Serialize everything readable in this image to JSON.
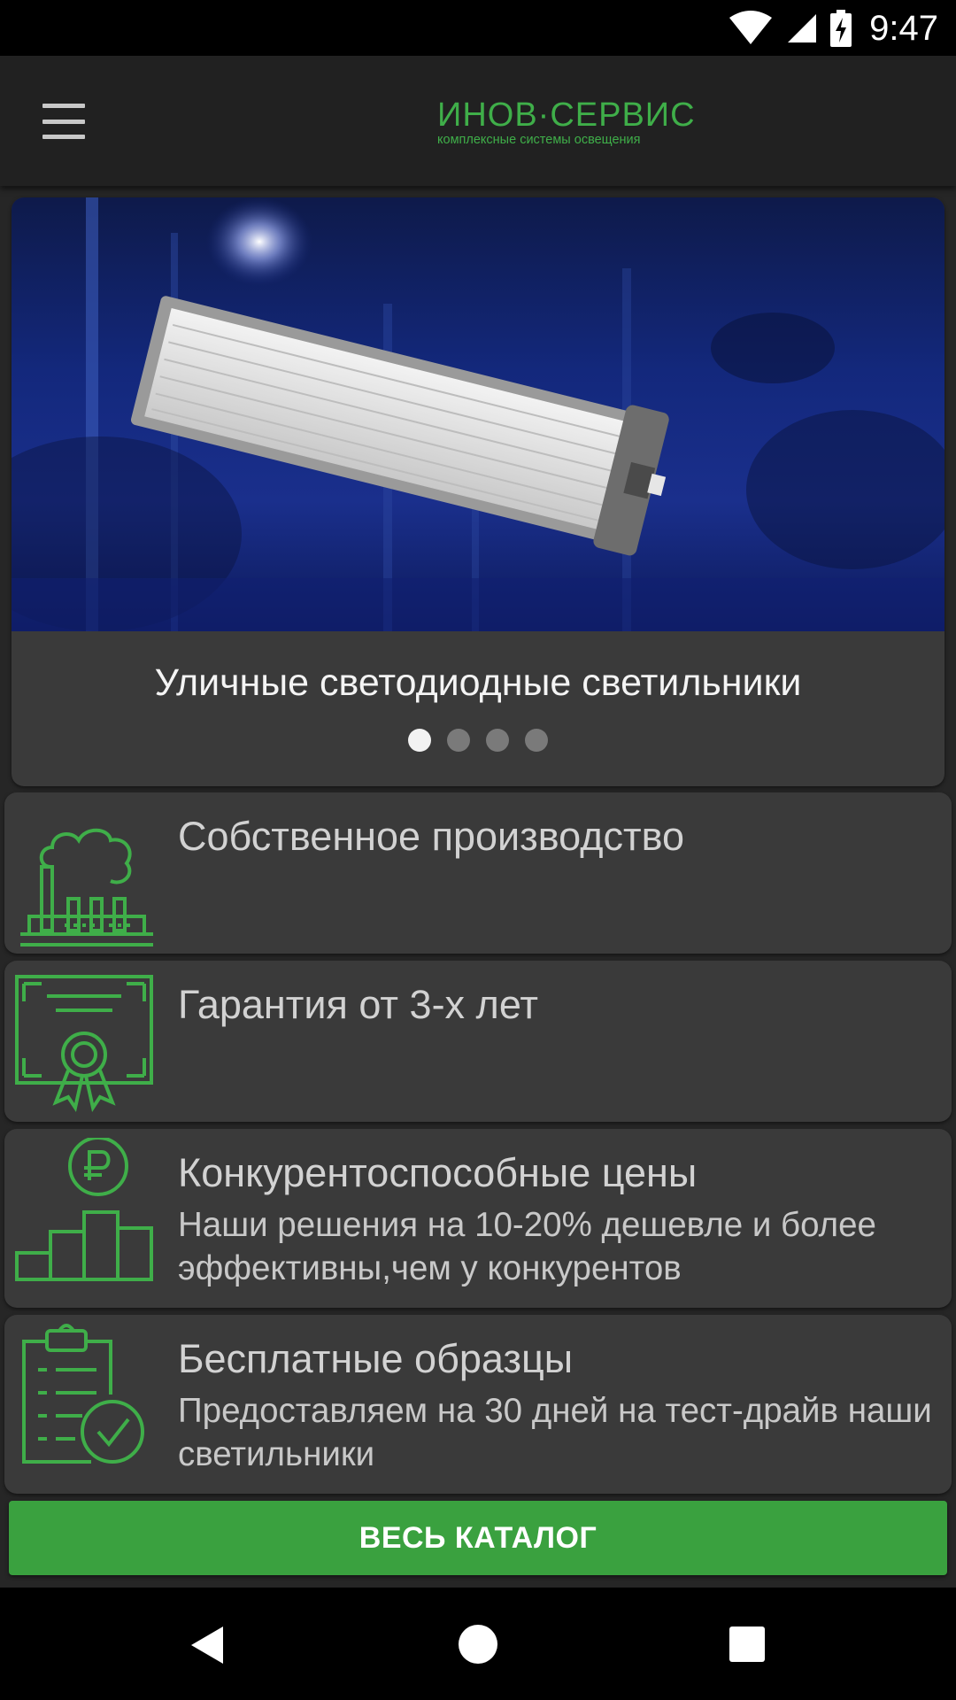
{
  "status_bar": {
    "time": "9:47",
    "icons": [
      "wifi-icon",
      "cellular-signal-icon",
      "battery-charging-icon"
    ]
  },
  "app_bar": {
    "menu_icon": "hamburger-menu-icon",
    "logo": {
      "title": "ИНОВ·СЕРВИС",
      "subtitle": "комплексные системы освещения"
    }
  },
  "banner": {
    "title": "Уличные светодиодные светильники",
    "slide_count": 4,
    "active_slide": 1
  },
  "features": [
    {
      "icon": "factory-icon",
      "title": "Собственное производство",
      "description": ""
    },
    {
      "icon": "certificate-icon",
      "title": "Гарантия от 3-х лет",
      "description": ""
    },
    {
      "icon": "ruble-price-chart-icon",
      "title": "Конкурентоспособные цены",
      "description": "Наши решения на 10-20% дешевле и более эффективны,чем у конкурентов"
    },
    {
      "icon": "clipboard-check-icon",
      "title": "Бесплатные образцы",
      "description": "Предоставляем на 30 дней на тест-драйв наши светильники"
    }
  ],
  "catalog_button": {
    "label": "ВЕСЬ КАТАЛОГ"
  },
  "nav_bar": {
    "icons": [
      "back-icon",
      "home-icon",
      "recents-icon"
    ]
  },
  "colors": {
    "accent_green": "#3fae49",
    "button_green": "#3aa13f",
    "card_bg": "#3a3a3a",
    "app_bar_bg": "#212121"
  }
}
